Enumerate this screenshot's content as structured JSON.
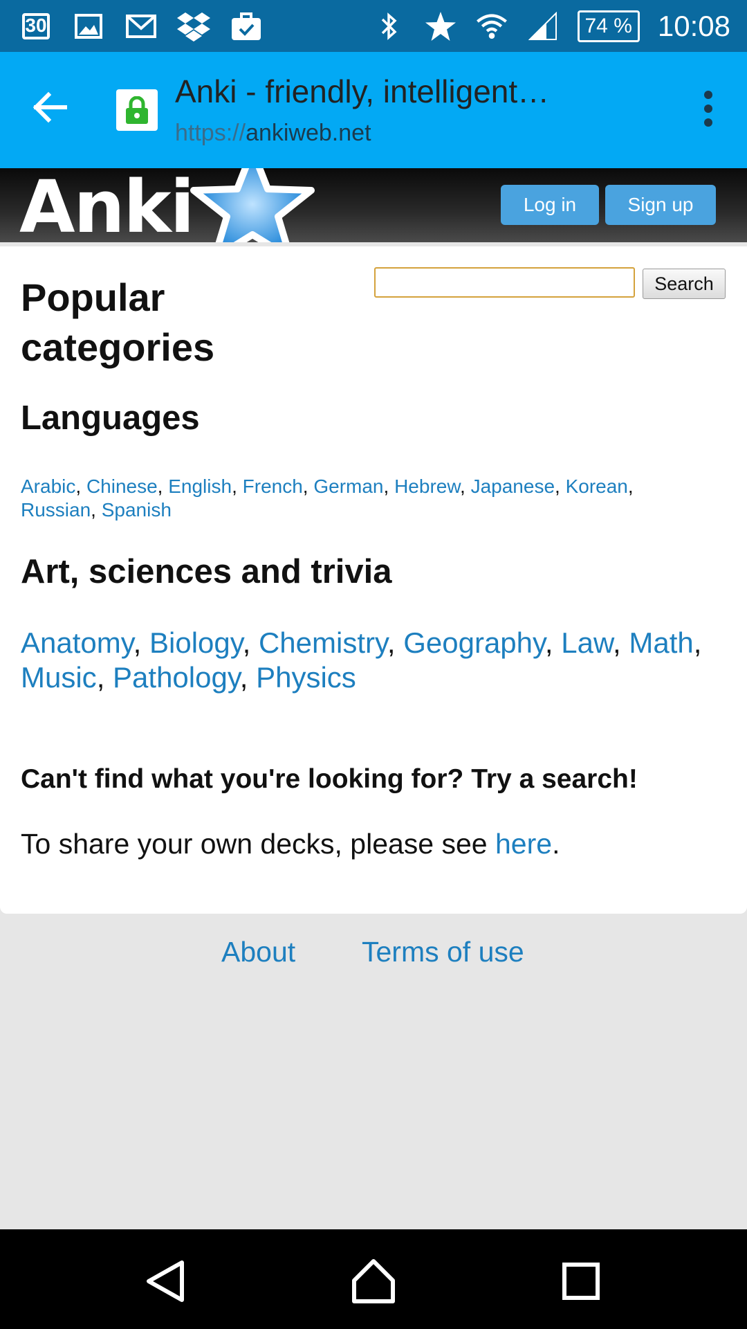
{
  "status_bar": {
    "calendar_day": "30",
    "battery": "74 %",
    "time": "10:08",
    "icons_left": [
      "calendar-icon",
      "gallery-icon",
      "gmail-icon",
      "dropbox-icon",
      "task-icon"
    ],
    "icons_right": [
      "bluetooth-icon",
      "star-icon",
      "wifi-icon",
      "signal-icon",
      "battery-icon"
    ]
  },
  "browser": {
    "title": "Anki - friendly, intelligent…",
    "url_scheme": "https://",
    "url_host": "ankiweb.net"
  },
  "header": {
    "logo_text": "Anki",
    "login_label": "Log in",
    "signup_label": "Sign up"
  },
  "search": {
    "value": "",
    "button_label": "Search"
  },
  "main": {
    "title": "Popular categories",
    "sections": [
      {
        "heading": "Languages",
        "links": [
          "Arabic",
          "Chinese",
          "English",
          "French",
          "German",
          "Hebrew",
          "Japanese",
          "Korean",
          "Russian",
          "Spanish"
        ]
      },
      {
        "heading": "Art, sciences and trivia",
        "links": [
          "Anatomy",
          "Biology",
          "Chemistry",
          "Geography",
          "Law",
          "Math",
          "Music",
          "Pathology",
          "Physics"
        ]
      }
    ],
    "cta": "Can't find what you're looking for? Try a search!",
    "share_prefix": "To share your own decks, please see ",
    "share_link": "here",
    "share_suffix": "."
  },
  "footer": {
    "about": "About",
    "terms": "Terms of use"
  },
  "colors": {
    "status_bar": "#0a6aa0",
    "toolbar": "#03a9f4",
    "link": "#1d7fbf",
    "header_button": "#4aa3df"
  }
}
